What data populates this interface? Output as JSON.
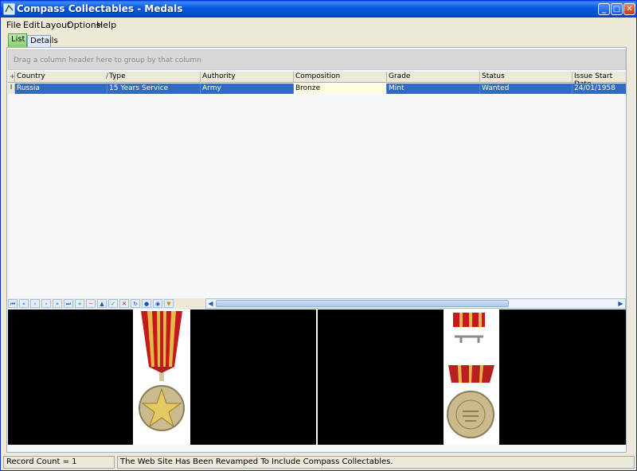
{
  "window": {
    "title": "Compass Collectables - Medals",
    "controls": {
      "minimize": "_",
      "maximize": "□",
      "close": "✕"
    }
  },
  "menu": [
    "File",
    "Edit",
    "Layout",
    "Options",
    "Help"
  ],
  "tabs": {
    "list": "List",
    "details": "Details"
  },
  "grid": {
    "group_hint": "Drag a column header here to group by that column",
    "sort_indicator": "/",
    "columns": [
      "Country",
      "Type",
      "Authority",
      "Composition",
      "Grade",
      "Status",
      "Issue Start Date"
    ],
    "rows": [
      {
        "indicator": "I",
        "cells": [
          "Russia",
          "15 Years Service",
          "Army",
          "Bronze",
          "Mint",
          "Wanted",
          "24/01/1958"
        ]
      }
    ]
  },
  "navigator": {
    "buttons": [
      "first",
      "prev-page",
      "prev",
      "next",
      "next-page",
      "last",
      "insert",
      "delete",
      "edit",
      "post",
      "cancel",
      "refresh",
      "bookmark",
      "goto-bookmark",
      "filter"
    ]
  },
  "status": {
    "record_count": "Record Count = 1",
    "message": "The Web Site Has Been Revamped To Include Compass Collectables."
  },
  "colors": {
    "selection": "#316ac5",
    "titlebar": "#0a5ae0"
  }
}
